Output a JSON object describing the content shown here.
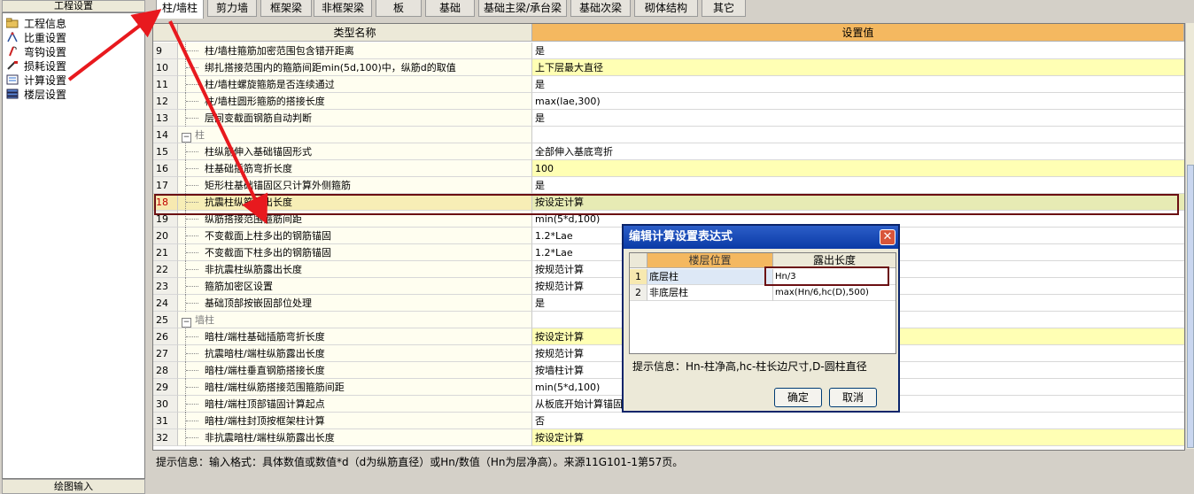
{
  "left_panel": {
    "header": "工程设置",
    "items": [
      {
        "label": "工程信息",
        "icon": "folder-icon"
      },
      {
        "label": "比重设置",
        "icon": "scale-icon"
      },
      {
        "label": "弯钩设置",
        "icon": "hook-icon"
      },
      {
        "label": "损耗设置",
        "icon": "loss-icon"
      },
      {
        "label": "计算设置",
        "icon": "calc-settings-icon"
      },
      {
        "label": "楼层设置",
        "icon": "floor-stack-icon"
      }
    ],
    "footer": "绘图输入"
  },
  "tabs": [
    {
      "label": "柱/墙柱",
      "active": true
    },
    {
      "label": "剪力墙"
    },
    {
      "label": "框架梁"
    },
    {
      "label": "非框架梁"
    },
    {
      "label": "板"
    },
    {
      "label": "基础"
    },
    {
      "label": "基础主梁/承台梁"
    },
    {
      "label": "基础次梁"
    },
    {
      "label": "砌体结构"
    },
    {
      "label": "其它"
    }
  ],
  "grid": {
    "columns": [
      "类型名称",
      "设置值"
    ],
    "rows": [
      {
        "num": "9",
        "name": "柱/墙柱箍筋加密范围包含错开距离",
        "value": "是"
      },
      {
        "num": "10",
        "name": "绑扎搭接范围内的箍筋间距min(5d,100)中，纵筋d的取值",
        "value": "上下层最大直径",
        "hl": true
      },
      {
        "num": "11",
        "name": "柱/墙柱螺旋箍筋是否连续通过",
        "value": "是"
      },
      {
        "num": "12",
        "name": "柱/墙柱圆形箍筋的搭接长度",
        "value": "max(lae,300)"
      },
      {
        "num": "13",
        "name": "层间变截面钢筋自动判断",
        "value": "是"
      },
      {
        "num": "14",
        "name": "柱",
        "value": "",
        "group": true
      },
      {
        "num": "15",
        "name": "柱纵筋伸入基础锚固形式",
        "value": "全部伸入基底弯折"
      },
      {
        "num": "16",
        "name": "柱基础插筋弯折长度",
        "value": "100",
        "hl": true
      },
      {
        "num": "17",
        "name": "矩形柱基础锚固区只计算外侧箍筋",
        "value": "是"
      },
      {
        "num": "18",
        "name": "抗震柱纵筋露出长度",
        "value": "按设定计算",
        "selected": true
      },
      {
        "num": "19",
        "name": "纵筋搭接范围箍筋间距",
        "value": "min(5*d,100)"
      },
      {
        "num": "20",
        "name": "不变截面上柱多出的钢筋锚固",
        "value": "1.2*Lae"
      },
      {
        "num": "21",
        "name": "不变截面下柱多出的钢筋锚固",
        "value": "1.2*Lae"
      },
      {
        "num": "22",
        "name": "非抗震柱纵筋露出长度",
        "value": "按规范计算"
      },
      {
        "num": "23",
        "name": "箍筋加密区设置",
        "value": "按规范计算"
      },
      {
        "num": "24",
        "name": "基础顶部按嵌固部位处理",
        "value": "是"
      },
      {
        "num": "25",
        "name": "墙柱",
        "value": "",
        "group": true
      },
      {
        "num": "26",
        "name": "暗柱/端柱基础插筋弯折长度",
        "value": "按设定计算",
        "hl": true
      },
      {
        "num": "27",
        "name": "抗震暗柱/端柱纵筋露出长度",
        "value": "按规范计算"
      },
      {
        "num": "28",
        "name": "暗柱/端柱垂直钢筋搭接长度",
        "value": "按墙柱计算"
      },
      {
        "num": "29",
        "name": "暗柱/端柱纵筋搭接范围箍筋间距",
        "value": "min(5*d,100)"
      },
      {
        "num": "30",
        "name": "暗柱/端柱顶部锚固计算起点",
        "value": "从板底开始计算锚固"
      },
      {
        "num": "31",
        "name": "暗柱/端柱封顶按框架柱计算",
        "value": "否"
      },
      {
        "num": "32",
        "name": "非抗震暗柱/端柱纵筋露出长度",
        "value": "按设定计算",
        "hl": true
      }
    ]
  },
  "status_text": "提示信息：输入格式：具体数值或数值*d（d为纵筋直径）或Hn/数值（Hn为层净高）。来源11G101-1第57页。",
  "dialog": {
    "title": "编辑计算设置表达式",
    "columns": [
      "楼层位置",
      "露出长度"
    ],
    "rows": [
      {
        "num": "1",
        "position": "底层柱",
        "length": "Hn/3"
      },
      {
        "num": "2",
        "position": "非底层柱",
        "length": "max(Hn/6,hc(D),500)"
      }
    ],
    "hint": "提示信息：Hn-柱净高,hc-柱长边尺寸,D-圆柱直径",
    "ok_label": "确定",
    "cancel_label": "取消"
  },
  "colors": {
    "highlight_row": "#ffffb4",
    "annotation_red": "#e8191e",
    "annotation_box": "#6b0f12",
    "dialog_title": "#0a3aa6",
    "column_header_orange": "#f4b860"
  }
}
